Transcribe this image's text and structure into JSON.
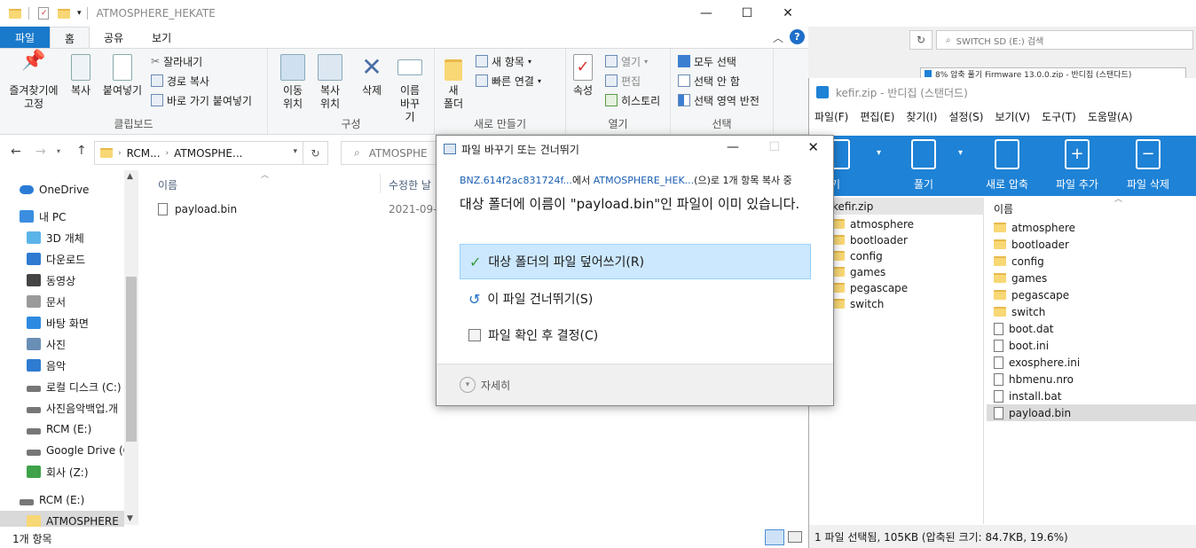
{
  "explorer": {
    "title": "ATMOSPHERE_HEKATE",
    "tabs": [
      "파일",
      "홈",
      "공유",
      "보기"
    ],
    "ribbon": {
      "clipboard": {
        "pin": "즐겨찾기에 고정",
        "copy": "복사",
        "paste": "붙여넣기",
        "cut": "잘라내기",
        "copy_path": "경로 복사",
        "paste_shortcut": "바로 가기 붙여넣기",
        "title": "클립보드"
      },
      "organize": {
        "move_to": "이동 위치",
        "copy_to": "복사 위치",
        "delete": "삭제",
        "rename": "이름 바꾸기",
        "title": "구성"
      },
      "new": {
        "new_folder": "새 폴더",
        "new_item": "새 항목",
        "easy_access": "빠른 연결",
        "title": "새로 만들기"
      },
      "open": {
        "properties": "속성",
        "open": "열기",
        "edit": "편집",
        "history": "히스토리",
        "title": "열기"
      },
      "select": {
        "select_all": "모두 선택",
        "select_none": "선택 안 함",
        "invert": "선택 영역 반전",
        "title": "선택"
      }
    },
    "breadcrumb": [
      "RCM...",
      "ATMOSPHE..."
    ],
    "search_placeholder": "ATMOSPHE",
    "columns": {
      "name": "이름",
      "modified": "수정한 날"
    },
    "files": [
      {
        "name": "payload.bin",
        "date": "2021-09-"
      }
    ],
    "nav": [
      {
        "label": "OneDrive",
        "icon": "cloud-icon"
      },
      {
        "label": "내 PC",
        "icon": "pc-icon"
      },
      {
        "label": "3D 개체",
        "icon": "3d-objects-icon"
      },
      {
        "label": "다운로드",
        "icon": "download-icon"
      },
      {
        "label": "동영상",
        "icon": "video-icon"
      },
      {
        "label": "문서",
        "icon": "document-icon"
      },
      {
        "label": "바탕 화면",
        "icon": "desktop-icon"
      },
      {
        "label": "사진",
        "icon": "pictures-icon"
      },
      {
        "label": "음악",
        "icon": "music-icon"
      },
      {
        "label": "로컬 디스크 (C:)",
        "icon": "drive-icon"
      },
      {
        "label": "사진음악백업.개",
        "icon": "drive-icon"
      },
      {
        "label": "RCM (E:)",
        "icon": "drive-icon"
      },
      {
        "label": "Google Drive (G",
        "icon": "drive-icon"
      },
      {
        "label": "회사 (Z:)",
        "icon": "network-drive-icon"
      },
      {
        "label": "RCM (E:)",
        "icon": "drive-icon"
      },
      {
        "label": "ATMOSPHERE_H",
        "icon": "folder-icon"
      }
    ],
    "status": "1개 항목"
  },
  "background": {
    "search_text": "SWITCH SD (E:) 검색",
    "progress_window_title": "8% 압축 풀기 Firmware 13.0.0.zip - 반디집 (스탠다드)"
  },
  "bandizip": {
    "title": "kefir.zip - 반디집 (스탠더드)",
    "menu": [
      "파일(F)",
      "편집(E)",
      "찾기(I)",
      "설정(S)",
      "보기(V)",
      "도구(T)",
      "도움말(A)"
    ],
    "toolbar": [
      "열기",
      "풀기",
      "새로 압축",
      "파일 추가",
      "파일 삭제"
    ],
    "tree_root": "kefir.zip",
    "tree": [
      "atmosphere",
      "bootloader",
      "config",
      "games",
      "pegascape",
      "switch"
    ],
    "list_header": "이름",
    "list": [
      {
        "name": "atmosphere",
        "type": "folder"
      },
      {
        "name": "bootloader",
        "type": "folder"
      },
      {
        "name": "config",
        "type": "folder"
      },
      {
        "name": "games",
        "type": "folder"
      },
      {
        "name": "pegascape",
        "type": "folder"
      },
      {
        "name": "switch",
        "type": "folder"
      },
      {
        "name": "boot.dat",
        "type": "file"
      },
      {
        "name": "boot.ini",
        "type": "file"
      },
      {
        "name": "exosphere.ini",
        "type": "file"
      },
      {
        "name": "hbmenu.nro",
        "type": "file"
      },
      {
        "name": "install.bat",
        "type": "file"
      },
      {
        "name": "payload.bin",
        "type": "file"
      }
    ],
    "status": "1 파일 선택됨, 105KB (압축된 크기: 84.7KB, 19.6%)"
  },
  "dialog": {
    "title": "파일 바꾸기 또는 건너뛰기",
    "source": "BNZ.614f2ac831724f...",
    "mid1": "에서 ",
    "dest": "ATMOSPHERE_HEK...",
    "mid2": "(으)로 1개 항목 복사 중",
    "message": "대상 폴더에 이름이 \"payload.bin\"인 파일이 이미 있습니다.",
    "options": [
      {
        "label": "대상 폴더의 파일 덮어쓰기(R)",
        "icon": "check-icon"
      },
      {
        "label": "이 파일 건너뛰기(S)",
        "icon": "skip-icon"
      },
      {
        "label": "파일 확인 후 결정(C)",
        "icon": "compare-icon"
      }
    ],
    "details": "자세히"
  },
  "colors": {
    "accent": "#1e82d6",
    "file_tab": "#1979ca",
    "selection": "#cce8ff"
  }
}
